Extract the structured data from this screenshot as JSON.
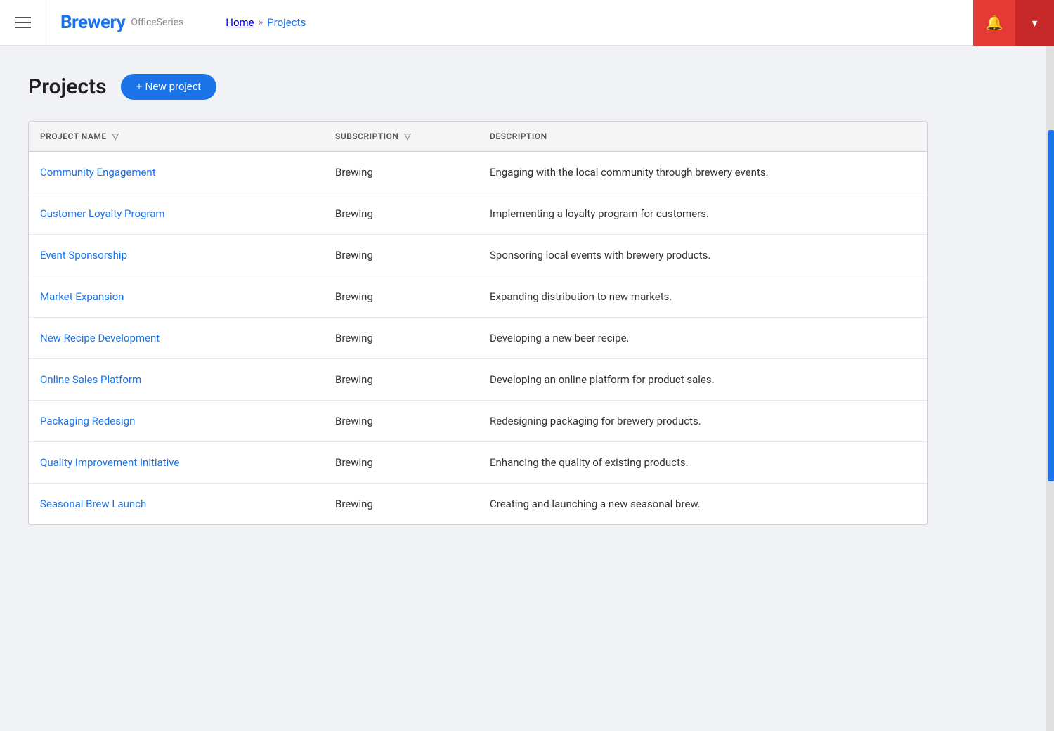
{
  "header": {
    "logo": "Brewery",
    "series": "OfficeSeries",
    "breadcrumb": {
      "home": "Home",
      "separator": "»",
      "current": "Projects"
    }
  },
  "page": {
    "title": "Projects",
    "new_project_label": "+ New project"
  },
  "table": {
    "columns": [
      {
        "id": "name",
        "label": "PROJECT NAME"
      },
      {
        "id": "subscription",
        "label": "SUBSCRIPTION"
      },
      {
        "id": "description",
        "label": "DESCRIPTION"
      }
    ],
    "rows": [
      {
        "name": "Community Engagement",
        "subscription": "Brewing",
        "description": "Engaging with the local community through brewery events."
      },
      {
        "name": "Customer Loyalty Program",
        "subscription": "Brewing",
        "description": "Implementing a loyalty program for customers."
      },
      {
        "name": "Event Sponsorship",
        "subscription": "Brewing",
        "description": "Sponsoring local events with brewery products."
      },
      {
        "name": "Market Expansion",
        "subscription": "Brewing",
        "description": "Expanding distribution to new markets."
      },
      {
        "name": "New Recipe Development",
        "subscription": "Brewing",
        "description": "Developing a new beer recipe."
      },
      {
        "name": "Online Sales Platform",
        "subscription": "Brewing",
        "description": "Developing an online platform for product sales."
      },
      {
        "name": "Packaging Redesign",
        "subscription": "Brewing",
        "description": "Redesigning packaging for brewery products."
      },
      {
        "name": "Quality Improvement Initiative",
        "subscription": "Brewing",
        "description": "Enhancing the quality of existing products."
      },
      {
        "name": "Seasonal Brew Launch",
        "subscription": "Brewing",
        "description": "Creating and launching a new seasonal brew."
      }
    ]
  },
  "colors": {
    "accent": "#1a73e8",
    "notification_bg": "#e53935",
    "dropdown_bg": "#c62828"
  }
}
